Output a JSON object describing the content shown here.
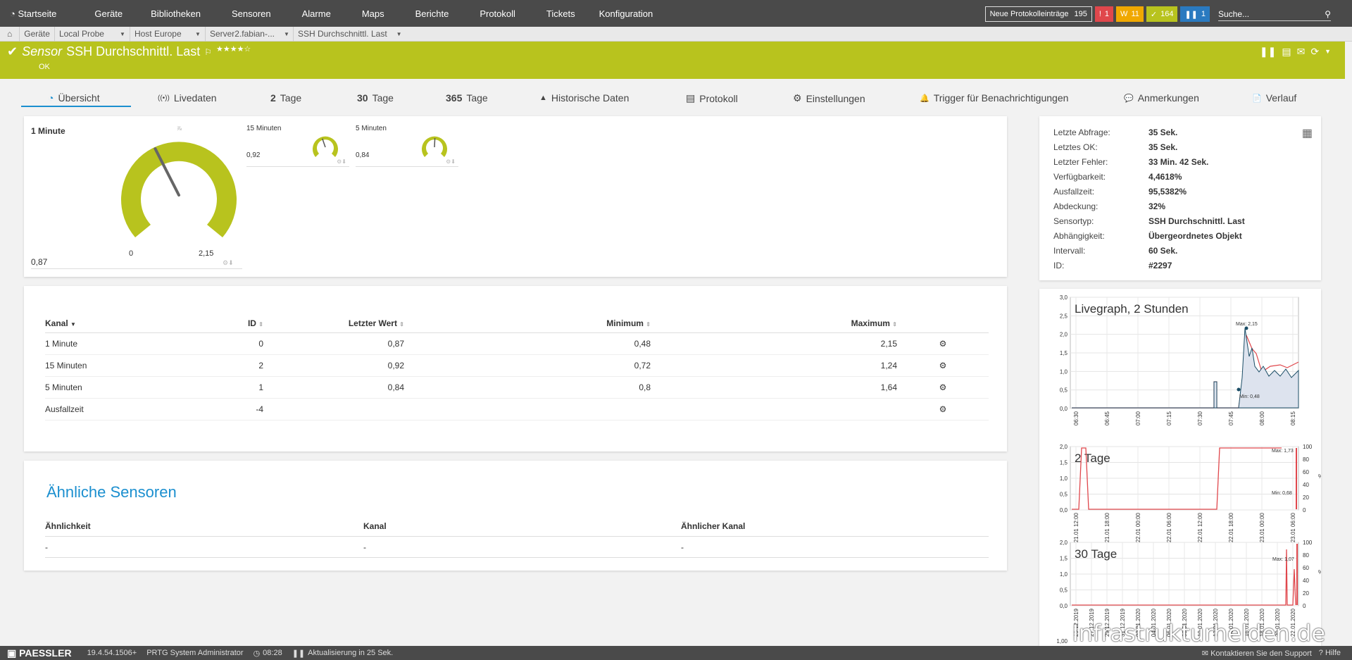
{
  "nav": {
    "items": [
      "Startseite",
      "Geräte",
      "Bibliotheken",
      "Sensoren",
      "Alarme",
      "Maps",
      "Berichte",
      "Protokoll",
      "Tickets",
      "Konfiguration"
    ],
    "log_label": "Neue Protokolleinträge",
    "log_count": "195",
    "badges": [
      {
        "label": "!",
        "count": "1",
        "color": "#e0474c"
      },
      {
        "label": "W",
        "count": "11",
        "color": "#f0a800"
      },
      {
        "label": "✓",
        "count": "164",
        "color": "#b8c31e"
      },
      {
        "label": "❚❚",
        "count": "1",
        "color": "#2a7ac0"
      }
    ],
    "search_placeholder": "Suche..."
  },
  "breadcrumb": [
    "Geräte",
    "Local Probe",
    "Host Europe",
    "Server2.fabian-...",
    "SSH Durchschnittl. Last"
  ],
  "sensor": {
    "prefix": "Sensor",
    "name": "SSH Durchschnittl. Last",
    "status": "OK",
    "stars": "★★★★☆"
  },
  "tabs": [
    {
      "icon": "◔",
      "num": "",
      "label": "Übersicht"
    },
    {
      "icon": "((•))",
      "num": "",
      "label": "Livedaten"
    },
    {
      "icon": "",
      "num": "2",
      "label": "Tage"
    },
    {
      "icon": "",
      "num": "30",
      "label": "Tage"
    },
    {
      "icon": "",
      "num": "365",
      "label": "Tage"
    },
    {
      "icon": "▲",
      "num": "",
      "label": "Historische Daten"
    },
    {
      "icon": "▤",
      "num": "",
      "label": "Protokoll"
    },
    {
      "icon": "⚙",
      "num": "",
      "label": "Einstellungen"
    },
    {
      "icon": "🔔",
      "num": "",
      "label": "Trigger für Benachrichtigungen"
    },
    {
      "icon": "💬",
      "num": "",
      "label": "Anmerkungen"
    },
    {
      "icon": "📄",
      "num": "",
      "label": "Verlauf"
    }
  ],
  "gauges": {
    "main": {
      "title": "1 Minute",
      "value": "0,87",
      "min": "0",
      "max": "2,15",
      "level": 0.4
    },
    "g15": {
      "title": "15 Minuten",
      "value": "0,92",
      "level": 0.43
    },
    "g5": {
      "title": "5 Minuten",
      "value": "0,84",
      "level": 0.51
    }
  },
  "info": [
    {
      "k": "Letzte Abfrage:",
      "v": "35 Sek."
    },
    {
      "k": "Letztes OK:",
      "v": "35 Sek."
    },
    {
      "k": "Letzter Fehler:",
      "v": "33 Min. 42 Sek."
    },
    {
      "k": "Verfügbarkeit:",
      "v": "4,4618%"
    },
    {
      "k": "Ausfallzeit:",
      "v": "95,5382%"
    },
    {
      "k": "Abdeckung:",
      "v": "32%"
    },
    {
      "k": "Sensortyp:",
      "v": "SSH Durchschnittl. Last"
    },
    {
      "k": "Abhängigkeit:",
      "v": "Übergeordnetes Objekt"
    },
    {
      "k": "Intervall:",
      "v": "60 Sek."
    },
    {
      "k": "ID:",
      "v": "#2297"
    }
  ],
  "channels": {
    "headers": [
      "Kanal",
      "ID",
      "Letzter Wert",
      "Minimum",
      "Maximum"
    ],
    "rows": [
      [
        "1 Minute",
        "0",
        "0,87",
        "0,48",
        "2,15"
      ],
      [
        "15 Minuten",
        "2",
        "0,92",
        "0,72",
        "1,24"
      ],
      [
        "5 Minuten",
        "1",
        "0,84",
        "0,8",
        "1,64"
      ],
      [
        "Ausfallzeit",
        "-4",
        "",
        "",
        ""
      ]
    ]
  },
  "similar": {
    "title": "Ähnliche Sensoren",
    "headers": [
      "Ähnlichkeit",
      "Kanal",
      "Ähnlicher Kanal"
    ],
    "row": [
      "-",
      "-",
      "-"
    ]
  },
  "graphs": {
    "live": {
      "title": "Livegraph, 2 Stunden",
      "yticks": [
        "3,0",
        "2,5",
        "2,0",
        "1,5",
        "1,0",
        "0,5",
        "0,0"
      ],
      "xticks": [
        "06:30",
        "06:45",
        "07:00",
        "07:15",
        "07:30",
        "07:45",
        "08:00",
        "08:15"
      ],
      "max_label": "Max: 2,15",
      "min_label": "Min: 0,48"
    },
    "d2": {
      "title": "2 Tage",
      "yticks": [
        "2,0",
        "1,5",
        "1,0",
        "0,5",
        "0,0"
      ],
      "y2ticks": [
        "100",
        "80",
        "60",
        "40",
        "20",
        "0"
      ],
      "xticks": [
        "21.01 12:00",
        "21.01 18:00",
        "22.01 00:00",
        "22.01 06:00",
        "22.01 12:00",
        "22.01 18:00",
        "23.01 00:00",
        "23.01 06:00"
      ],
      "max_label": "Max: 1,73",
      "min_label": "Min: 0,68",
      "y2label": "%"
    },
    "d30": {
      "title": "30 Tage",
      "yticks": [
        "2,0",
        "1,5",
        "1,0",
        "0,5",
        "0,0"
      ],
      "y2ticks": [
        "100",
        "80",
        "60",
        "40",
        "20",
        "0"
      ],
      "xticks": [
        "25.12.2019",
        "27.12.2019",
        "29.12.2019",
        "31.12.2019",
        "02.01.2020",
        "04.01.2020",
        "06.01.2020",
        "08.01.2020",
        "10.01.2020",
        "12.01.2020",
        "14.01.2020",
        "16.01.2020",
        "18.01.2020",
        "20.01.2020",
        "22.01.2020"
      ],
      "max_label": "Max: 1,07",
      "y2label": "%",
      "below_tick": "1,00"
    }
  },
  "footer": {
    "brand": "PAESSLER",
    "version": "19.4.54.1506+",
    "user": "PRTG System Administrator",
    "time": "08:28",
    "refresh": "Aktualisierung in 25 Sek.",
    "support": "Kontaktieren Sie den Support",
    "help": "Hilfe"
  },
  "watermark": "Infrastrukturhelden.de",
  "colors": {
    "accent": "#b8c31e",
    "link": "#1b8fcf",
    "nav": "#4a4a4a"
  }
}
